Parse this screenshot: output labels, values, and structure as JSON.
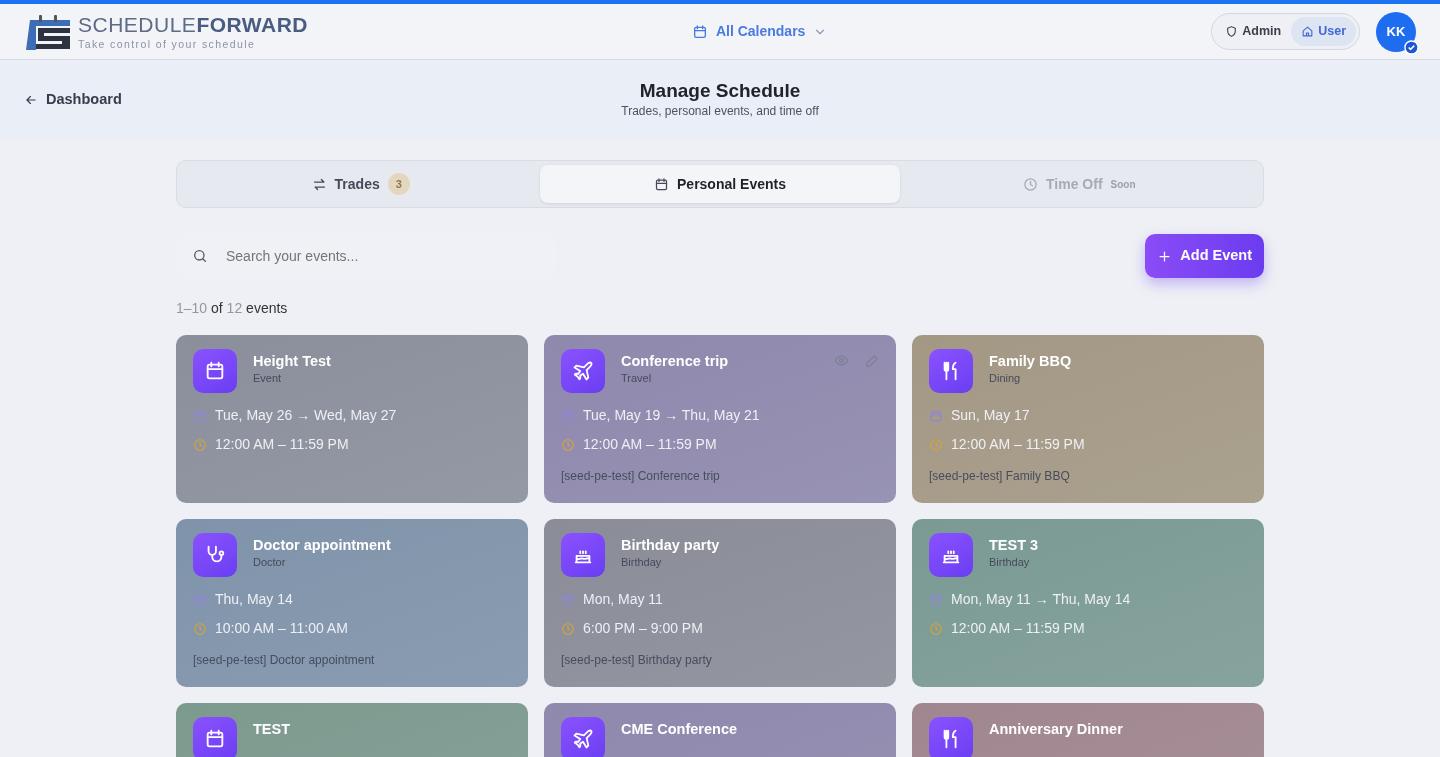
{
  "brand": {
    "name_light": "SCHEDULE",
    "name_bold": "FORWARD",
    "tagline": "Take control of your schedule"
  },
  "calendar_picker": {
    "label": "All Calendars"
  },
  "roles": [
    {
      "label": "Admin",
      "kind": "shield",
      "selected": false
    },
    {
      "label": "User",
      "kind": "home",
      "selected": true
    }
  ],
  "avatar": {
    "initials": "KK",
    "verified": true
  },
  "back_link": {
    "label": "Dashboard"
  },
  "page": {
    "title": "Manage Schedule",
    "subtitle": "Trades, personal events, and time off"
  },
  "tabs": [
    {
      "label": "Trades",
      "kind": "swap",
      "badge": "3",
      "selected": false,
      "disabled": false
    },
    {
      "label": "Personal Events",
      "kind": "calendar",
      "selected": true,
      "disabled": false
    },
    {
      "label": "Time Off",
      "kind": "clock",
      "tag": "Soon",
      "selected": false,
      "disabled": true
    }
  ],
  "search": {
    "placeholder": "Search your events..."
  },
  "add_button": {
    "label": "Add Event"
  },
  "count": {
    "range": "1–10",
    "of": "of",
    "total": "12",
    "unit": "events"
  },
  "events": [
    {
      "title": "Height Test",
      "category": "Event",
      "kind": "calendar",
      "dates": "Tue, May 26 → Wed, May 27",
      "time": "12:00 AM – 11:59 PM",
      "color": "#8a8f9b",
      "hovered": false
    },
    {
      "title": "Conference trip",
      "category": "Travel",
      "kind": "travel",
      "dates": "Tue, May 19 → Thu, May 21",
      "time": "12:00 AM – 11:59 PM",
      "note": "[seed-pe-test] Conference trip",
      "color": "#8e89ad",
      "hovered": true
    },
    {
      "title": "Family BBQ",
      "category": "Dining",
      "kind": "dining",
      "dates": "Sun, May 17",
      "time": "12:00 AM – 11:59 PM",
      "note": "[seed-pe-test] Family BBQ",
      "color": "#a39884",
      "hovered": false
    },
    {
      "title": "Doctor appointment",
      "category": "Doctor",
      "kind": "doctor",
      "dates": "Thu, May 14",
      "time": "10:00 AM – 11:00 AM",
      "note": "[seed-pe-test] Doctor appointment",
      "color": "#7f93aa",
      "hovered": false
    },
    {
      "title": "Birthday party",
      "category": "Birthday",
      "kind": "birthday",
      "dates": "Mon, May 11",
      "time": "6:00 PM – 9:00 PM",
      "note": "[seed-pe-test] Birthday party",
      "color": "#8a8c97",
      "hovered": false
    },
    {
      "title": "TEST 3",
      "category": "Birthday",
      "kind": "birthday",
      "dates": "Mon, May 11 → Thu, May 14",
      "time": "12:00 AM – 11:59 PM",
      "color": "#7b9a94",
      "hovered": false
    },
    {
      "title": "TEST",
      "kind": "calendar",
      "color": "#7d9a8f",
      "hovered": false
    },
    {
      "title": "CME Conference",
      "kind": "travel",
      "color": "#8e89ad",
      "hovered": false
    },
    {
      "title": "Anniversary Dinner",
      "kind": "dining",
      "color": "#a0868f",
      "hovered": false
    }
  ]
}
